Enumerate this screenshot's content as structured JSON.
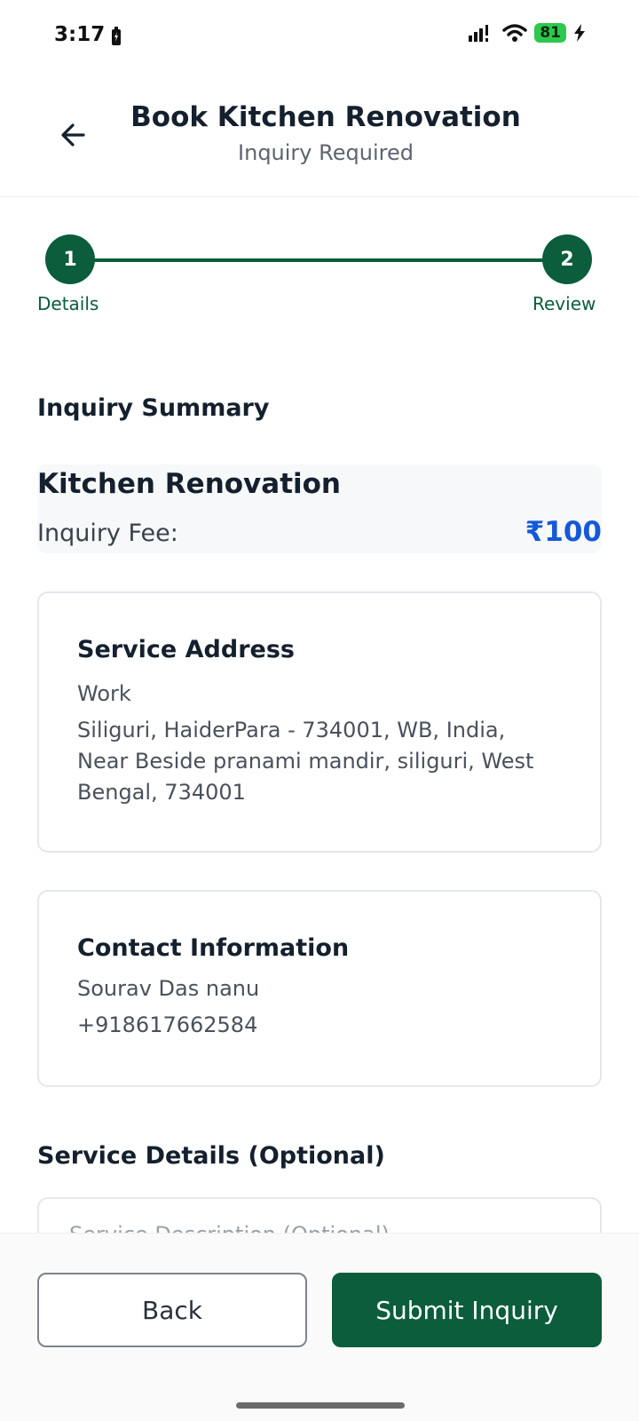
{
  "status_bar": {
    "time": "3:17",
    "battery": "81"
  },
  "header": {
    "title": "Book Kitchen Renovation",
    "subtitle": "Inquiry Required"
  },
  "stepper": {
    "steps": [
      {
        "number": "1",
        "label": "Details"
      },
      {
        "number": "2",
        "label": "Review"
      }
    ]
  },
  "summary": {
    "title": "Inquiry Summary",
    "service_name": "Kitchen Renovation",
    "fee_label": "Inquiry Fee:",
    "fee_value": "₹100"
  },
  "address": {
    "title": "Service Address",
    "type": "Work",
    "line1": "Siliguri, HaiderPara - 734001, WB, India,",
    "line2": "Near Beside pranami mandir, siliguri, West",
    "line3": "Bengal, 734001"
  },
  "contact": {
    "title": "Contact Information",
    "name": "Sourav Das nanu",
    "phone": "+918617662584"
  },
  "service_details": {
    "title": "Service Details (Optional)",
    "description_placeholder": "Service Description (Optional)"
  },
  "actions": {
    "back_label": "Back",
    "submit_label": "Submit Inquiry"
  },
  "colors": {
    "primary": "#0b5d3b",
    "fee": "#1559d6",
    "battery": "#2dc84d"
  }
}
